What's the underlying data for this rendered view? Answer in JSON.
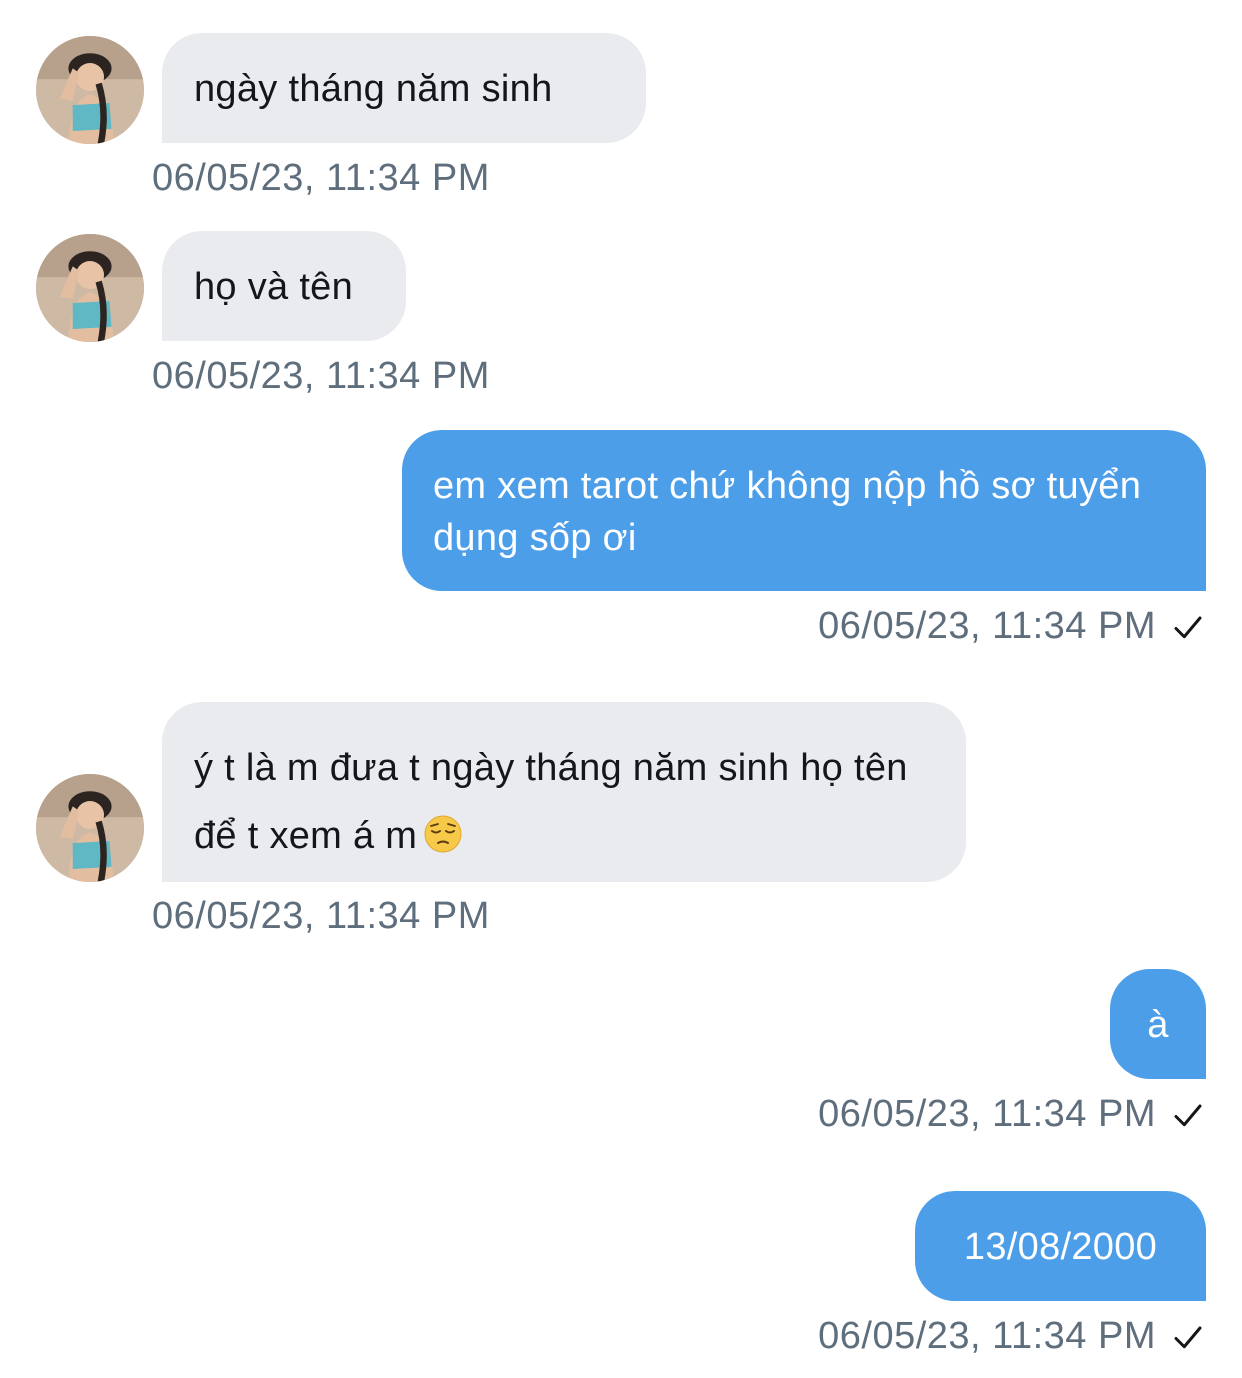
{
  "messages": [
    {
      "direction": "incoming",
      "text": "ngày tháng năm sinh",
      "timestamp": "06/05/23, 11:34 PM"
    },
    {
      "direction": "incoming",
      "text": "họ và tên",
      "timestamp": "06/05/23, 11:34 PM"
    },
    {
      "direction": "outgoing",
      "text": "em xem tarot chứ không nộp hồ sơ tuyển dụng sốp ơi",
      "timestamp": "06/05/23, 11:34 PM",
      "status": "sent"
    },
    {
      "direction": "incoming",
      "text": "ý t là m đưa t ngày tháng năm sinh họ tên để t xem á m",
      "emoji": "pensive-face",
      "timestamp": "06/05/23, 11:34 PM"
    },
    {
      "direction": "outgoing",
      "text": "à",
      "timestamp": "06/05/23, 11:34 PM",
      "status": "sent"
    },
    {
      "direction": "outgoing",
      "text": "13/08/2000",
      "timestamp": "06/05/23, 11:34 PM",
      "status": "sent"
    }
  ],
  "colors": {
    "incoming_bubble": "#e9ebef",
    "outgoing_bubble": "#4c9ee8",
    "timestamp_text": "#5f6e7c"
  },
  "icons": {
    "avatar": "contact-avatar",
    "sent_status": "checkmark-icon"
  }
}
